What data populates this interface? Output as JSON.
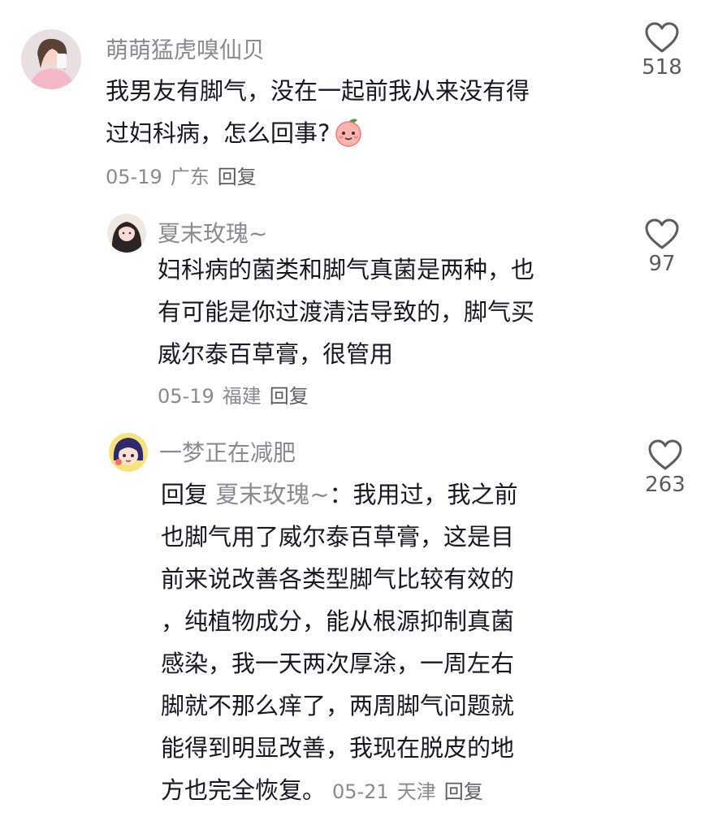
{
  "comments": [
    {
      "username": "萌萌猛虎嗅仙贝",
      "lines": [
        "我男友有脚气，没在一起前我从来没有得",
        "过妇科病，怎么回事?"
      ],
      "emoji": "peach-face-emoji",
      "date": "05-19",
      "location": "广东",
      "reply_label": "回复",
      "likes": "518"
    },
    {
      "username": "夏末玫瑰~",
      "lines": [
        "妇科病的菌类和脚气真菌是两种，也",
        "有可能是你过渡清洁导致的，脚气买",
        "威尔泰百草膏，很管用"
      ],
      "date": "05-19",
      "location": "福建",
      "reply_label": "回复",
      "likes": "97"
    },
    {
      "username": "一梦正在减肥",
      "reply_prefix": "回复 ",
      "reply_target": "夏末玫瑰~",
      "reply_colon": "：我用过，我之前",
      "lines": [
        "也脚气用了威尔泰百草膏，这是目",
        "前来说改善各类型脚气比较有效的",
        "，纯植物成分，能从根源抑制真菌",
        "感染，我一天两次厚涂，一周左右",
        "脚就不那么痒了，两周脚气问题就",
        "能得到明显改善，我现在脱皮的地"
      ],
      "last_line": "方也完全恢复。",
      "date": "05-21",
      "location": "天津",
      "reply_label": "回复",
      "likes": "263"
    }
  ],
  "icons": {
    "like": "heart-outline-icon"
  },
  "colors": {
    "text": "#161823",
    "secondary": "#8a8b91",
    "icon": "#5b5c63"
  }
}
